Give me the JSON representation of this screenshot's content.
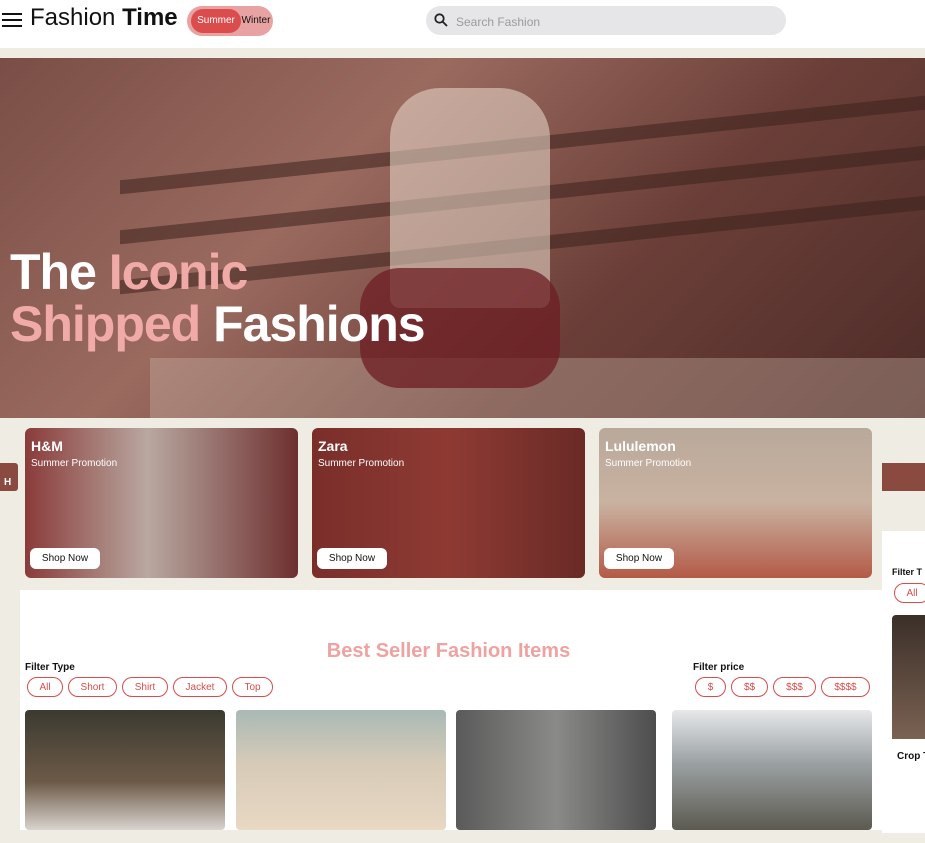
{
  "header": {
    "brand_light": "Fashion ",
    "brand_bold": "Time",
    "season_active": "Summer",
    "season_inactive": "Winter",
    "search_placeholder": "Search Fashion"
  },
  "hero": {
    "line1_white": "The ",
    "line1_pink": "Iconic",
    "line2_pink": "Shipped",
    "line2_white": " Fashions"
  },
  "brands": [
    {
      "name": "H&M",
      "promo": "Summer Promotion",
      "cta": "Shop Now"
    },
    {
      "name": "Zara",
      "promo": "Summer Promotion",
      "cta": "Shop Now"
    },
    {
      "name": "Lululemon",
      "promo": "Summer Promotion",
      "cta": "Shop Now"
    }
  ],
  "best_seller": {
    "title": "Best Seller Fashion Items",
    "filter_type_label": "Filter Type",
    "filter_types": [
      "All",
      "Short",
      "Shirt",
      "Jacket",
      "Top"
    ],
    "filter_price_label": "Filter price",
    "filter_prices": [
      "$",
      "$$",
      "$$$",
      "$$$$"
    ]
  },
  "ghost_right": {
    "filter_label": "Filter T",
    "pill": "All",
    "caption": "Crop T"
  },
  "ghost_left": {
    "text": "H"
  },
  "colors": {
    "accent_red": "#d94c4c",
    "accent_pink": "#eea3a1",
    "toggle_bg": "#e8a2a2"
  }
}
